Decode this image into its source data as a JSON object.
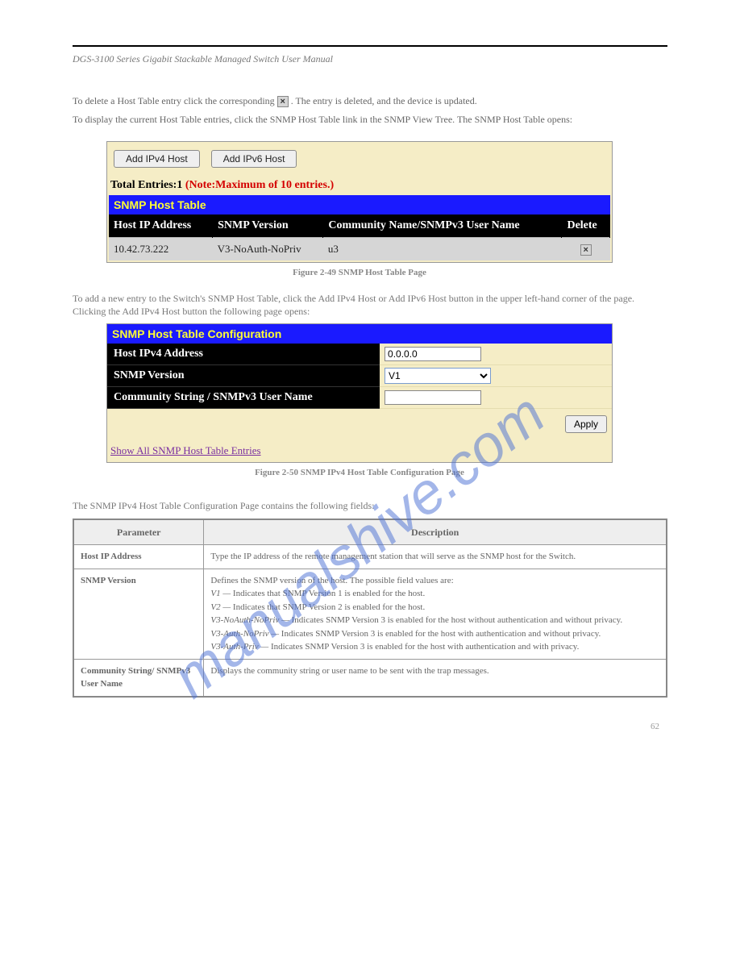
{
  "header": {
    "left": "DGS-3100 Series Gigabit Stackable Managed Switch User Manual",
    "right": ""
  },
  "intro": {
    "p1_a": "To delete a Host Table entry click the corresponding ",
    "p1_b": ". The entry is deleted, and the device is updated.",
    "p2": "To display the current Host Table entries, click the SNMP Host Table link in the SNMP View Tree. The SNMP Host Table opens:"
  },
  "icon": {
    "x": "×"
  },
  "snmp_table": {
    "buttons": {
      "add_ipv4": "Add IPv4 Host",
      "add_ipv6": "Add IPv6 Host"
    },
    "totals_label": "Total Entries:",
    "totals_value": "1",
    "totals_note": "(Note:Maximum of 10 entries.)",
    "title": "SNMP Host Table",
    "cols": {
      "ip": "Host IP Address",
      "ver": "SNMP Version",
      "comm": "Community Name/SNMPv3 User Name",
      "del": "Delete"
    },
    "row": {
      "ip": "10.42.73.222",
      "ver": "V3-NoAuth-NoPriv",
      "comm": "u3"
    }
  },
  "fig1_caption": "Figure 2-49 SNMP Host Table Page",
  "subhead_text": "To add a new entry to the Switch's SNMP Host Table, click the Add IPv4 Host or Add IPv6 Host button in the upper left-hand corner of the page. Clicking the Add IPv4 Host button the following page opens:",
  "config_panel": {
    "title": "SNMP Host Table Configuration",
    "rows": {
      "ip_label": "Host IPv4 Address",
      "ip_value": "0.0.0.0",
      "ver_label": "SNMP Version",
      "ver_value": "V1",
      "comm_label": "Community String / SNMPv3 User Name",
      "comm_value": ""
    },
    "apply": "Apply",
    "link": "Show All SNMP Host Table Entries"
  },
  "fig2_caption": "Figure 2-50 SNMP IPv4 Host Table Configuration Page",
  "param_lead": "The SNMP IPv4 Host Table Configuration Page contains the following fields:",
  "param_table": {
    "col_param": "Parameter",
    "col_desc": "Description",
    "rows": [
      {
        "param": "Host IP Address",
        "desc": "Type the IP address of the remote management station that will serve as the SNMP host for the Switch."
      },
      {
        "param": "SNMP Version",
        "desc_intro": "Defines the SNMP version of the host. The possible field values are:",
        "items": [
          {
            "term": "V1 —",
            "text": " Indicates that SNMP Version 1 is enabled for the host."
          },
          {
            "term": "V2 —",
            "text": " Indicates that SNMP Version 2 is enabled for the host."
          },
          {
            "term": "V3-NoAuth-NoPriv —",
            "text": " Indicates SNMP Version 3 is enabled for the host without authentication and without privacy."
          },
          {
            "term": "V3-Auth-NoPriv —",
            "text": " Indicates SNMP Version 3 is enabled for the host with authentication and without privacy."
          },
          {
            "term": "V3-Auth-Priv —",
            "text": " Indicates SNMP Version 3 is enabled for the host with authentication and with privacy."
          }
        ]
      },
      {
        "param": "Community String/ SNMPv3 User Name",
        "desc": "Displays the community string or user name to be sent with the trap messages."
      }
    ]
  },
  "page_number": "62",
  "watermark_text": "manualshive.com"
}
